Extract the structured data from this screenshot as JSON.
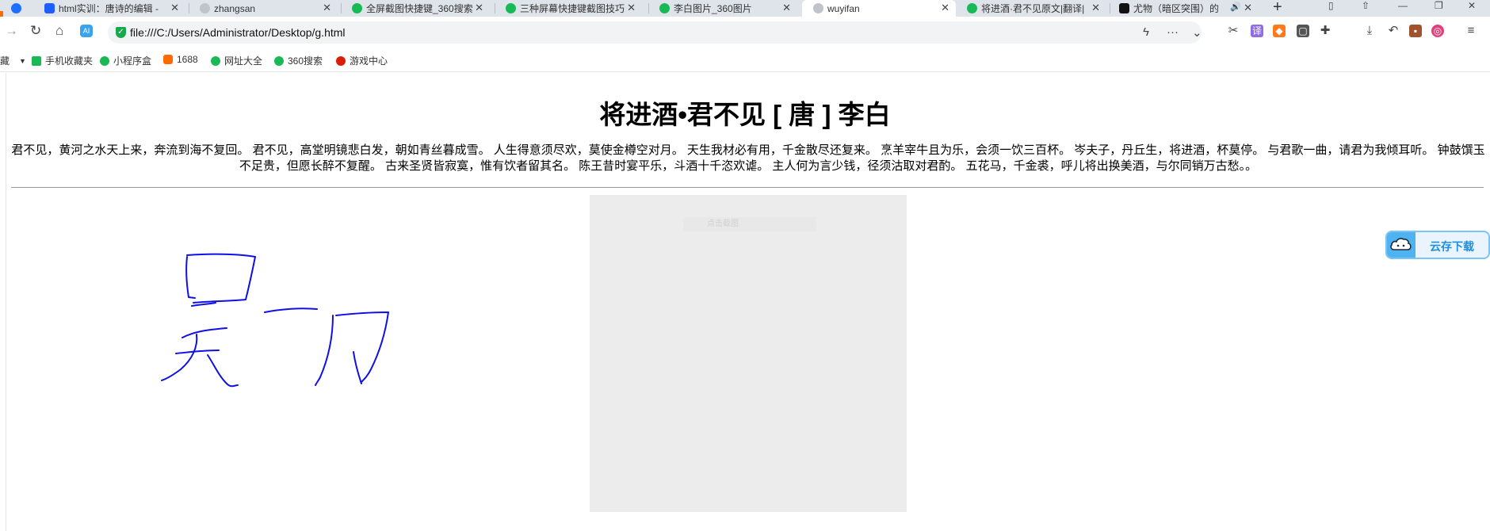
{
  "tabs": [
    {
      "label": "html实训：唐诗的编辑 -",
      "color": "#1e5eff",
      "active": false
    },
    {
      "label": "zhangsan",
      "color": "#9aa0a6",
      "active": false
    },
    {
      "label": "全屏截图快捷键_360搜索",
      "color": "#19b955",
      "active": false
    },
    {
      "label": "三种屏幕快捷键截图技巧",
      "color": "#19b955",
      "active": false
    },
    {
      "label": "李白图片_360图片",
      "color": "#19b955",
      "active": false
    },
    {
      "label": "wuyifan",
      "color": "#9aa0a6",
      "active": true
    },
    {
      "label": "将进酒·君不见原文|翻译|",
      "color": "#19b955",
      "active": false
    },
    {
      "label": "尤物（暗区突围）的",
      "color": "#111111",
      "active": false
    }
  ],
  "address": {
    "url": "file:///C:/Users/Administrator/Desktop/g.html"
  },
  "bookmarks": [
    {
      "label": "藏",
      "color": "#ffb400"
    },
    {
      "label": "手机收藏夹",
      "color": "#19b955"
    },
    {
      "label": "小程序盒",
      "color": "#19b955"
    },
    {
      "label": "1688",
      "color": "#ff6a00"
    },
    {
      "label": "网址大全",
      "color": "#19b955"
    },
    {
      "label": "360搜索",
      "color": "#19b955"
    },
    {
      "label": "游戏中心",
      "color": "#d81e06"
    }
  ],
  "poem": {
    "title": "将进酒•君不见 [ 唐 ] 李白",
    "body": "君不见，黄河之水天上来，奔流到海不复回。 君不见，高堂明镜悲白发，朝如青丝暮成雪。 人生得意须尽欢，莫使金樽空对月。 天生我材必有用，千金散尽还复来。 烹羊宰牛且为乐，会须一饮三百杯。 岑夫子，丹丘生，将进酒，杯莫停。 与君歌一曲，请君为我倾耳听。 钟鼓馔玉不足贵，但愿长醉不复醒。 古来圣贤皆寂寞，惟有饮者留其名。 陈王昔时宴平乐，斗酒十千恣欢谑。 主人何为言少钱，径须沽取对君酌。 五花马，千金裘，呼儿将出换美酒，与尔同销万古愁。。"
  },
  "image": {
    "caption": "点击截图"
  },
  "cloud": {
    "label": "云存下载"
  },
  "colors": {
    "ink": "#1010e6",
    "accent": "#1e8fe0"
  }
}
